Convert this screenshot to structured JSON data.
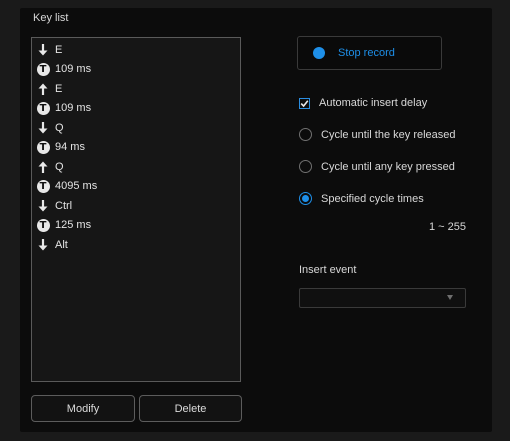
{
  "key_list": {
    "label": "Key list",
    "rows": [
      {
        "icon": "arrow-down-icon",
        "text": "E"
      },
      {
        "icon": "timer-icon",
        "text": "109 ms"
      },
      {
        "icon": "arrow-up-icon",
        "text": "E"
      },
      {
        "icon": "timer-icon",
        "text": "109 ms"
      },
      {
        "icon": "arrow-down-icon",
        "text": "Q"
      },
      {
        "icon": "timer-icon",
        "text": "94 ms"
      },
      {
        "icon": "arrow-up-icon",
        "text": "Q"
      },
      {
        "icon": "timer-icon",
        "text": "4095 ms"
      },
      {
        "icon": "arrow-down-icon",
        "text": "Ctrl"
      },
      {
        "icon": "timer-icon",
        "text": "125 ms"
      },
      {
        "icon": "arrow-down-icon",
        "text": "Alt"
      }
    ],
    "timer_glyph": "T"
  },
  "buttons": {
    "modify": "Modify",
    "delete": "Delete",
    "stop_record": "Stop record"
  },
  "options": {
    "auto_insert_delay": {
      "label": "Automatic insert delay",
      "checked": true
    },
    "cycle_until_released": {
      "label": "Cycle until the key released",
      "selected": false
    },
    "cycle_until_any_key": {
      "label": "Cycle until any key pressed",
      "selected": false
    },
    "specified_cycle_times": {
      "label": "Specified cycle times",
      "selected": true
    },
    "cycle_range": "1 ~ 255"
  },
  "insert_event": {
    "label": "Insert event",
    "value": ""
  },
  "colors": {
    "accent": "#1e8fe8",
    "background": "#0c0c0c",
    "outer": "#1a1a1a"
  }
}
